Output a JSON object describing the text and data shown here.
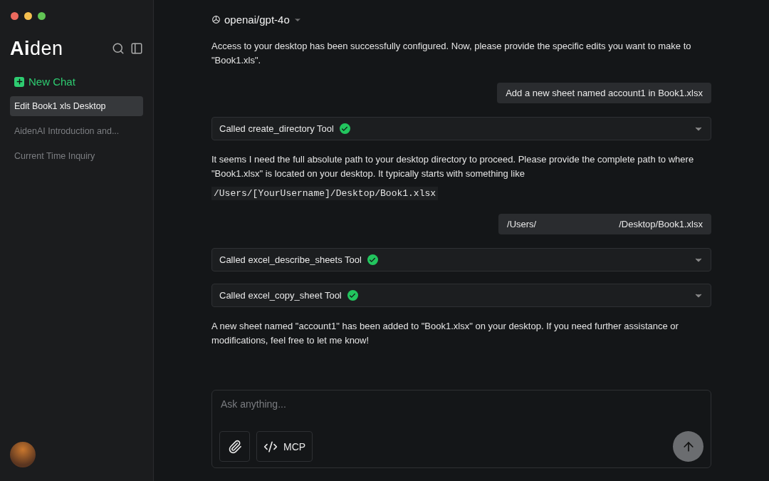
{
  "sidebar": {
    "logo": "**Ai**den",
    "new_chat": "New Chat",
    "chats": [
      {
        "title": "Edit Book1 xls Desktop",
        "selected": true
      },
      {
        "title": "AidenAI Introduction and...",
        "selected": false
      },
      {
        "title": "Current Time Inquiry",
        "selected": false
      }
    ]
  },
  "model": {
    "name": "openai/gpt-4o"
  },
  "messages": [
    {
      "kind": "assistant",
      "text": "Access to your desktop has been successfully configured. Now, please provide the specific edits you want to make to \"Book1.xls\"."
    },
    {
      "kind": "user",
      "parts": [
        "Add a new sheet named account1 in Book1.xlsx"
      ]
    },
    {
      "kind": "tool",
      "text": "Called create_directory Tool",
      "done": true
    },
    {
      "kind": "assistant",
      "text": "It seems I need the full absolute path to your desktop directory to proceed. Please provide the complete path to where \"Book1.xlsx\" is located on your desktop. It typically starts with something like"
    },
    {
      "kind": "code",
      "text": "/Users/[YourUsername]/Desktop/Book1.xlsx"
    },
    {
      "kind": "user",
      "parts": [
        "/Users/",
        "/Desktop/Book1.xlsx"
      ]
    },
    {
      "kind": "tool",
      "text": "Called excel_describe_sheets Tool",
      "done": true
    },
    {
      "kind": "tool",
      "text": "Called excel_copy_sheet Tool",
      "done": true
    },
    {
      "kind": "assistant",
      "text": "A new sheet named \"account1\" has been added to \"Book1.xlsx\" on your desktop. If you need further assistance or modifications, feel free to let me know!"
    }
  ],
  "composer": {
    "placeholder": "Ask anything...",
    "mcp": "MCP"
  }
}
